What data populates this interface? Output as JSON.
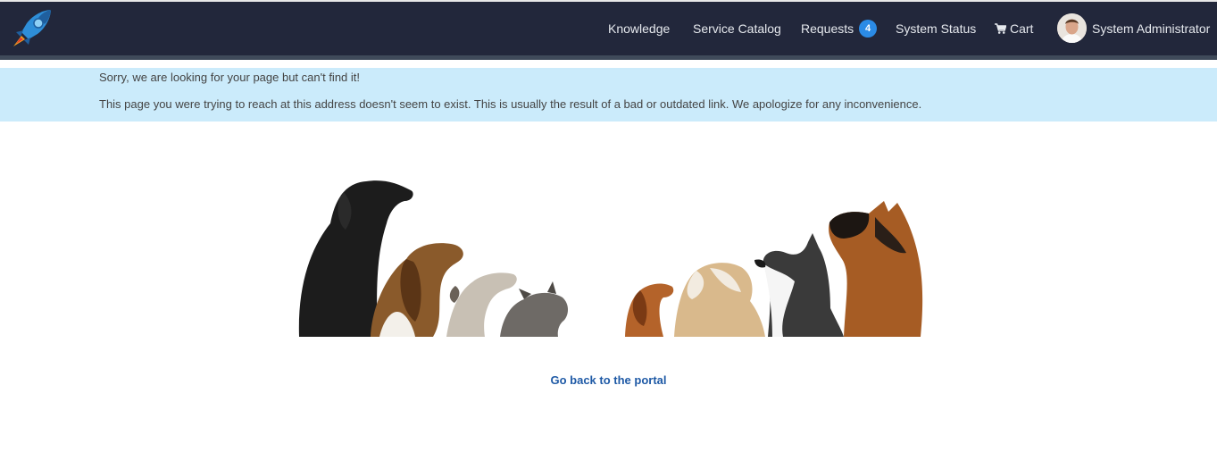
{
  "nav": {
    "items": [
      {
        "label": "Knowledge"
      },
      {
        "label": "Service Catalog"
      },
      {
        "label": "Requests",
        "badge": "4"
      },
      {
        "label": "System Status"
      },
      {
        "label": "Cart",
        "icon": "cart-icon"
      }
    ],
    "user": {
      "name": "System Administrator",
      "avatar": "avatar"
    },
    "logo": "rocket-logo",
    "colors": {
      "navbar": "#22273b",
      "badge": "#2b8be6",
      "alert_bg": "#cbebfb",
      "link": "#1f5aa6"
    }
  },
  "alert": {
    "title": "Sorry, we are looking for your page but can't find it!",
    "message": "This page you were trying to reach at this address doesn't seem to exist. This is usually the result of a bad or outdated link. We apologize for any inconvenience."
  },
  "illustration": {
    "subject": "dogs-looking-up-image"
  },
  "link": {
    "label": "Go back to the portal"
  }
}
